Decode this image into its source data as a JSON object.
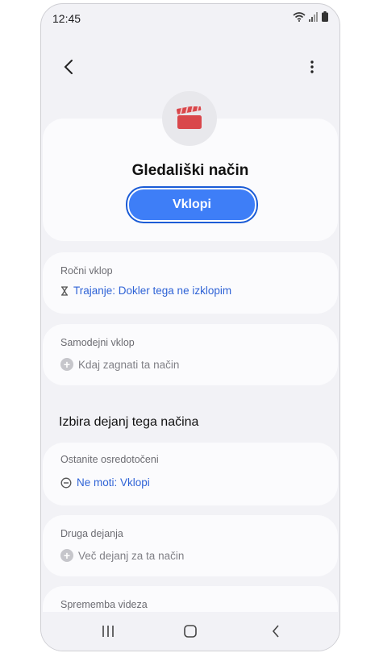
{
  "status_bar": {
    "time": "12:45"
  },
  "hero": {
    "title": "Gledališki način",
    "button_label": "Vklopi"
  },
  "manual_on": {
    "title": "Ročni vklop",
    "value": "Trajanje: Dokler tega ne izklopim"
  },
  "auto_on": {
    "title": "Samodejni vklop",
    "action": "Kdaj zagnati ta način"
  },
  "actions_heading": "Izbira dejanj tega načina",
  "stay_focused": {
    "title": "Ostanite osredotočeni",
    "value": "Ne moti: Vklopi"
  },
  "other_actions": {
    "title": "Druga dejanja",
    "action": "Več dejanj za ta način"
  },
  "appearance": {
    "title": "Sprememba videza"
  },
  "colors": {
    "accent": "#3e7ef7",
    "link": "#2f63d6",
    "icon_red": "#d9474b"
  }
}
